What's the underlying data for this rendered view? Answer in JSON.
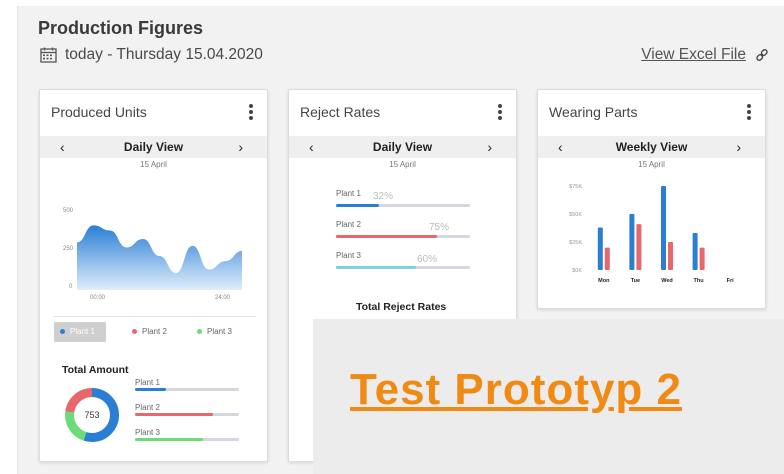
{
  "header": {
    "title": "Production Figures",
    "date": "today - Thursday 15.04.2020",
    "excel_link": "View Excel File"
  },
  "cards": {
    "produced": {
      "title": "Produced Units",
      "view": "Daily View",
      "prev": "‹",
      "next": "›",
      "date": "15 April",
      "y_ticks": [
        "500",
        "250",
        "0"
      ],
      "x_ticks": [
        "00:00",
        "24:00"
      ],
      "legend": [
        "Plant 1",
        "Plant 2",
        "Plant 3"
      ],
      "total_title": "Total Amount",
      "total_value": "753",
      "plants": [
        {
          "label": "Plant 1",
          "fraction": 0.3
        },
        {
          "label": "Plant 2",
          "fraction": 0.75
        },
        {
          "label": "Plant 3",
          "fraction": 0.65
        }
      ]
    },
    "reject": {
      "title": "Reject Rates",
      "view": "Daily View",
      "prev": "‹",
      "next": "›",
      "date": "15 April",
      "plants": [
        {
          "label": "Plant 1",
          "pct": "32%",
          "fraction": 0.32
        },
        {
          "label": "Plant 2",
          "pct": "75%",
          "fraction": 0.75
        },
        {
          "label": "Plant 3",
          "pct": "60%",
          "fraction": 0.6
        }
      ],
      "total_title": "Total Reject Rates"
    },
    "wearing": {
      "title": "Wearing Parts",
      "view": "Weekly View",
      "prev": "‹",
      "next": "›",
      "date": "15 April"
    }
  },
  "colors": {
    "plant1": "#2a7fd4",
    "plant2": "#e8676b",
    "plant3": "#6cdc7a",
    "plant3_reject": "#7cd1e3",
    "link": "#f08a12"
  },
  "chart_data": [
    {
      "type": "area",
      "title": "",
      "ylim": [
        0,
        500
      ],
      "y_ticks": [
        0,
        250,
        500
      ],
      "x": [
        "00:00",
        "24:00"
      ],
      "series": [
        {
          "name": "Plant 1",
          "values": [
            280,
            380,
            350,
            250,
            300,
            200,
            100,
            260,
            120,
            170,
            230
          ]
        }
      ]
    },
    {
      "type": "bar",
      "title": "",
      "categories": [
        "Mon",
        "Tue",
        "Wed",
        "Thu",
        "Fri"
      ],
      "y_ticks": [
        "$0K",
        "$25K",
        "$50K",
        "$75K"
      ],
      "ylim": [
        0,
        75
      ],
      "series": [
        {
          "name": "Plant 1",
          "values": [
            38,
            50,
            75,
            33,
            0
          ]
        },
        {
          "name": "Plant 2",
          "values": [
            20,
            41,
            25,
            20,
            0
          ]
        }
      ]
    },
    {
      "type": "pie",
      "title": "Total Amount",
      "center_label": "753",
      "series": [
        {
          "name": "Plant 1",
          "values": [
            0.55
          ]
        },
        {
          "name": "Plant 3",
          "values": [
            0.22
          ]
        },
        {
          "name": "Plant 2",
          "values": [
            0.23
          ]
        }
      ]
    }
  ],
  "overlay": {
    "link_text": "Test Prototyp 2"
  }
}
